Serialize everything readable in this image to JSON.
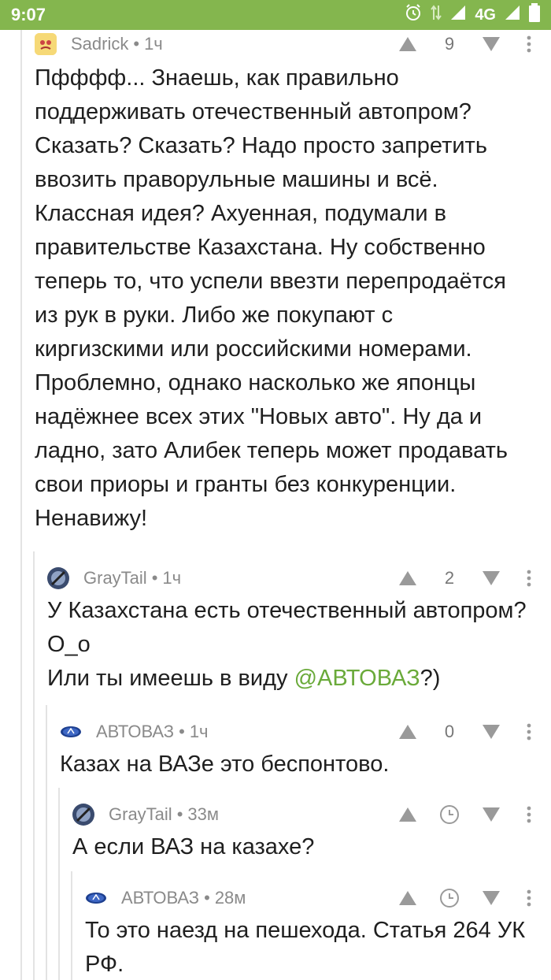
{
  "status_bar": {
    "time": "9:07",
    "network": "4G",
    "color": "#84b64e"
  },
  "comments": [
    {
      "author": "Sadrick",
      "time": "1ч",
      "rating": "9",
      "avatar_icon": "avatar-sadrick-icon",
      "lines": [
        "Пфффф... Знаешь, как правильно",
        "поддерживать отечественный автопром?",
        "Сказать? Сказать? Надо просто запретить",
        "ввозить праворульные машины и всё.",
        "Классная идея? Ахуенная, подумали в",
        "правительстве Казахстана. Ну собственно",
        "теперь то, что успели ввезти перепродаётся",
        "из рук в руки. Либо же покупают с",
        "киргизскими или российскими номерами.",
        "Проблемно, однако насколько же японцы",
        "надёжнее всех этих \"Новых авто\". Ну да и",
        "ладно, зато Алибек теперь может продавать",
        "свои приоры и гранты без конкуренции.",
        "Ненавижу!"
      ]
    },
    {
      "author": "GrayTail",
      "time": "1ч",
      "rating": "2",
      "lines": [
        "У Казахстана есть отечественный автопром?",
        "O_o"
      ],
      "line3_prefix": "Или ты имеешь в виду ",
      "mention": "@АВТОВАЗ",
      "line3_suffix": "?)"
    },
    {
      "author": "АВТОВАЗ",
      "time": "1ч",
      "rating": "0",
      "lines": [
        "Казах на ВАЗе это беспонтово."
      ]
    },
    {
      "author": "GrayTail",
      "time": "33м",
      "lines": [
        "А если ВАЗ на казахе?"
      ]
    },
    {
      "author": "АВТОВАЗ",
      "time": "28м",
      "lines": [
        "То это наезд на пешехода. Статья 264 УК",
        "РФ."
      ]
    }
  ],
  "colors": {
    "meta_text": "#8a8a8a",
    "mention": "#6aaa3a",
    "icon_gray": "#9a9a9a"
  }
}
